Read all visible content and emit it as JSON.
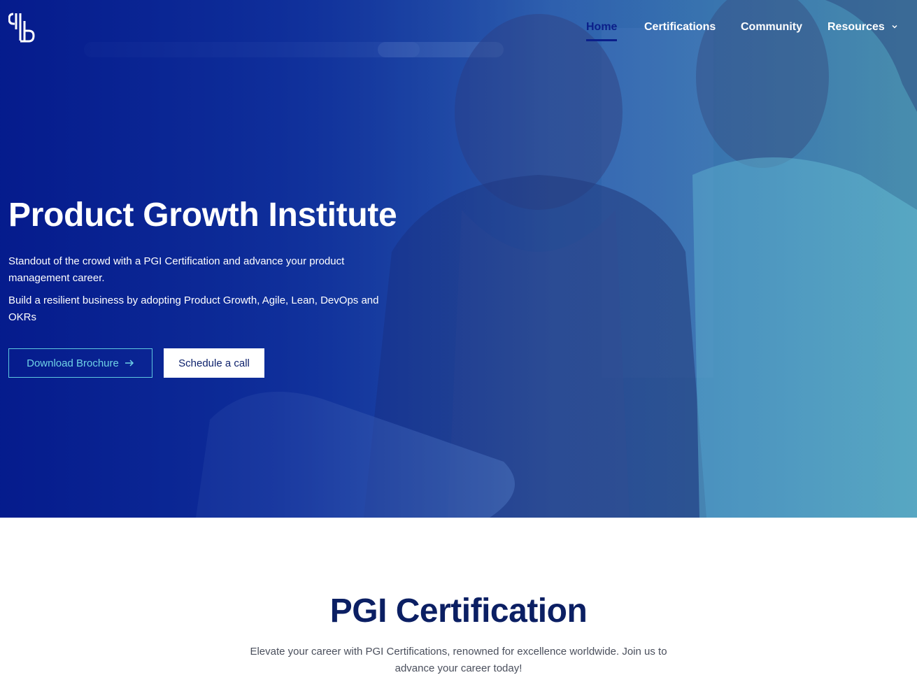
{
  "brand": {
    "logo_icon": "pgi-logo-icon"
  },
  "nav": {
    "items": [
      {
        "label": "Home",
        "active": true
      },
      {
        "label": "Certifications",
        "active": false
      },
      {
        "label": "Community",
        "active": false
      },
      {
        "label": "Resources",
        "active": false,
        "has_dropdown": true
      }
    ]
  },
  "hero": {
    "title": "Product Growth Institute",
    "paragraph_1": "Standout of the crowd with a PGI Certification and advance your product management career.",
    "paragraph_2": "Build a resilient business by adopting Product Growth, Agile, Lean, DevOps and OKRs",
    "download_button": "Download Brochure",
    "schedule_button": "Schedule a call"
  },
  "certification_section": {
    "title": "PGI Certification",
    "description": "Elevate your career with PGI Certifications, renowned for excellence worldwide. Join us to advance your career today!"
  },
  "colors": {
    "hero_overlay": "#0a1f8c",
    "accent_cyan": "#6fd2e6",
    "heading_navy": "#0b1f63",
    "body_gray": "#4a4f5c"
  }
}
